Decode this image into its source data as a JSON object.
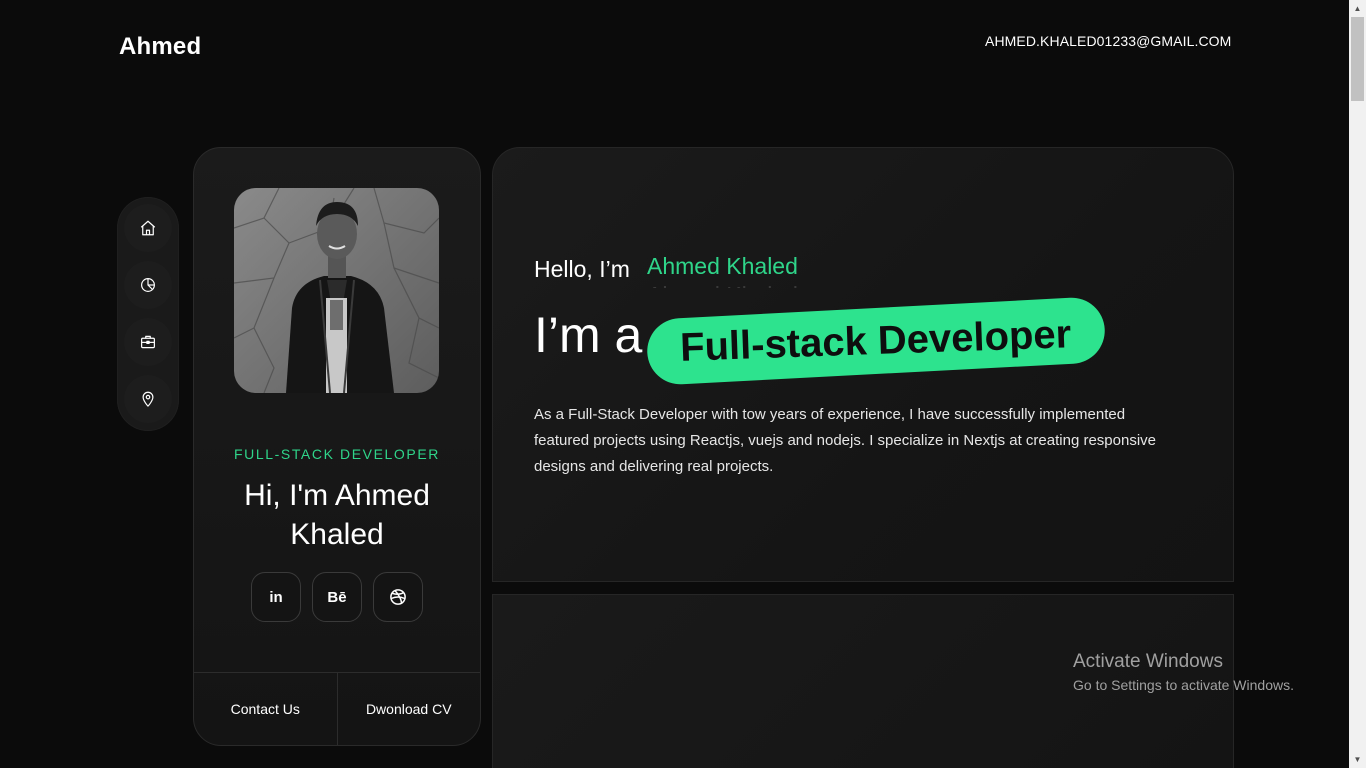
{
  "header": {
    "brand": "Ahmed",
    "email": "AHMED.KHALED01233@GMAIL.COM"
  },
  "side_nav": {
    "items": [
      {
        "icon": "home-icon"
      },
      {
        "icon": "pie-chart-icon"
      },
      {
        "icon": "briefcase-icon"
      },
      {
        "icon": "location-pin-icon"
      }
    ]
  },
  "profile": {
    "role": "FULL-STACK DEVELOPER",
    "greeting": "Hi, I'm Ahmed Khaled",
    "socials": [
      {
        "label": "in",
        "icon": "linkedin-icon"
      },
      {
        "label": "Bē",
        "icon": "behance-icon"
      },
      {
        "icon": "dribbble-icon"
      }
    ],
    "contact_label": "Contact Us",
    "download_label": "Dwonload CV"
  },
  "hero": {
    "hello": "Hello, I’m",
    "name": "Ahmed Khaled",
    "im_a": "I’m a",
    "highlight": "Full-stack Developer",
    "bio": "As a Full-Stack Developer with tow years of experience, I have successfully implemented featured projects using Reactjs, vuejs and nodejs. I specialize in Nextjs at creating responsive designs and delivering real projects."
  },
  "watermark": {
    "title": "Activate Windows",
    "subtitle": "Go to Settings to activate Windows."
  },
  "colors": {
    "accent": "#2de38e",
    "accent_text": "#2fd58a",
    "background": "#0b0b0b",
    "card": "#1b1b1b"
  }
}
